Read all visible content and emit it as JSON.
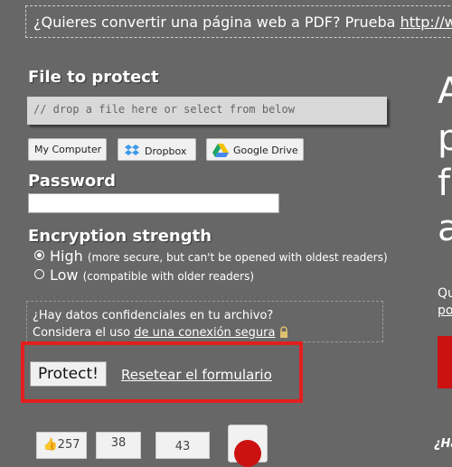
{
  "promo": {
    "text": "¿Quieres convertir una página web a PDF? Prueba ",
    "link": "http://www.htm"
  },
  "file_section": {
    "title": "File to protect",
    "drop_placeholder": "// drop a file here or select from below"
  },
  "sources": [
    {
      "label": "My Computer",
      "icon": "none"
    },
    {
      "label": "Dropbox",
      "icon": "dropbox-icon"
    },
    {
      "label": "Google Drive",
      "icon": "google-drive-icon"
    }
  ],
  "password": {
    "title": "Password",
    "value": ""
  },
  "encryption": {
    "title": "Encryption strength",
    "options": [
      {
        "label": "High",
        "note": "(more secure, but can't be opened with oldest readers)",
        "selected": true
      },
      {
        "label": "Low",
        "note": "(compatible with older readers)",
        "selected": false
      }
    ]
  },
  "notice": {
    "line1": "¿Hay datos confidenciales en tu archivo?",
    "line2_prefix": "Considera el uso ",
    "line2_link": "de una conexión segura"
  },
  "actions": {
    "protect_label": "Protect!",
    "reset_label": "Resetear el formulario"
  },
  "right_panel": {
    "letters": [
      "A",
      "p",
      "f",
      "a"
    ],
    "text1": "Qu",
    "text2": "po",
    "text3": "¿Ha"
  },
  "share": {
    "like_count": "257",
    "count_2": "38",
    "count_3": "43"
  },
  "colors": {
    "background": "#676767",
    "highlight": "#e41e1e"
  }
}
